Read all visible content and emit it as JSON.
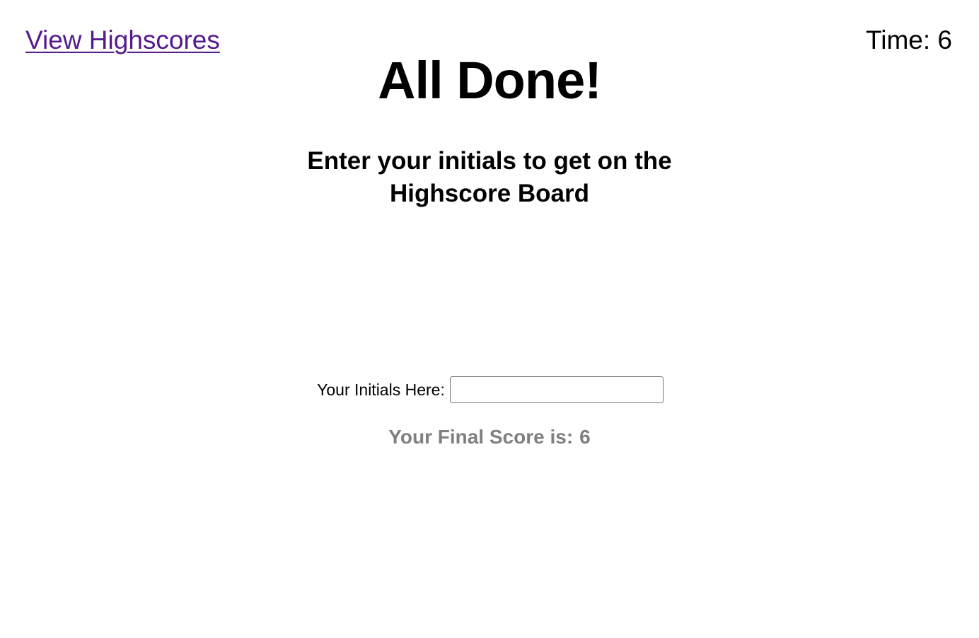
{
  "header": {
    "highscores_link": "View Highscores",
    "timer_label": "Time:",
    "timer_value": "6"
  },
  "main": {
    "title": "All Done!",
    "subtitle": "Enter your initials to get on the Highscore Board"
  },
  "form": {
    "initials_label": "Your Initials Here:",
    "initials_value": "",
    "initials_placeholder": ""
  },
  "result": {
    "final_score_label": "Your Final Score is:",
    "final_score_value": "6"
  },
  "colors": {
    "link": "#551a8b",
    "score_text": "#808080",
    "text": "#000000",
    "background": "#ffffff"
  }
}
